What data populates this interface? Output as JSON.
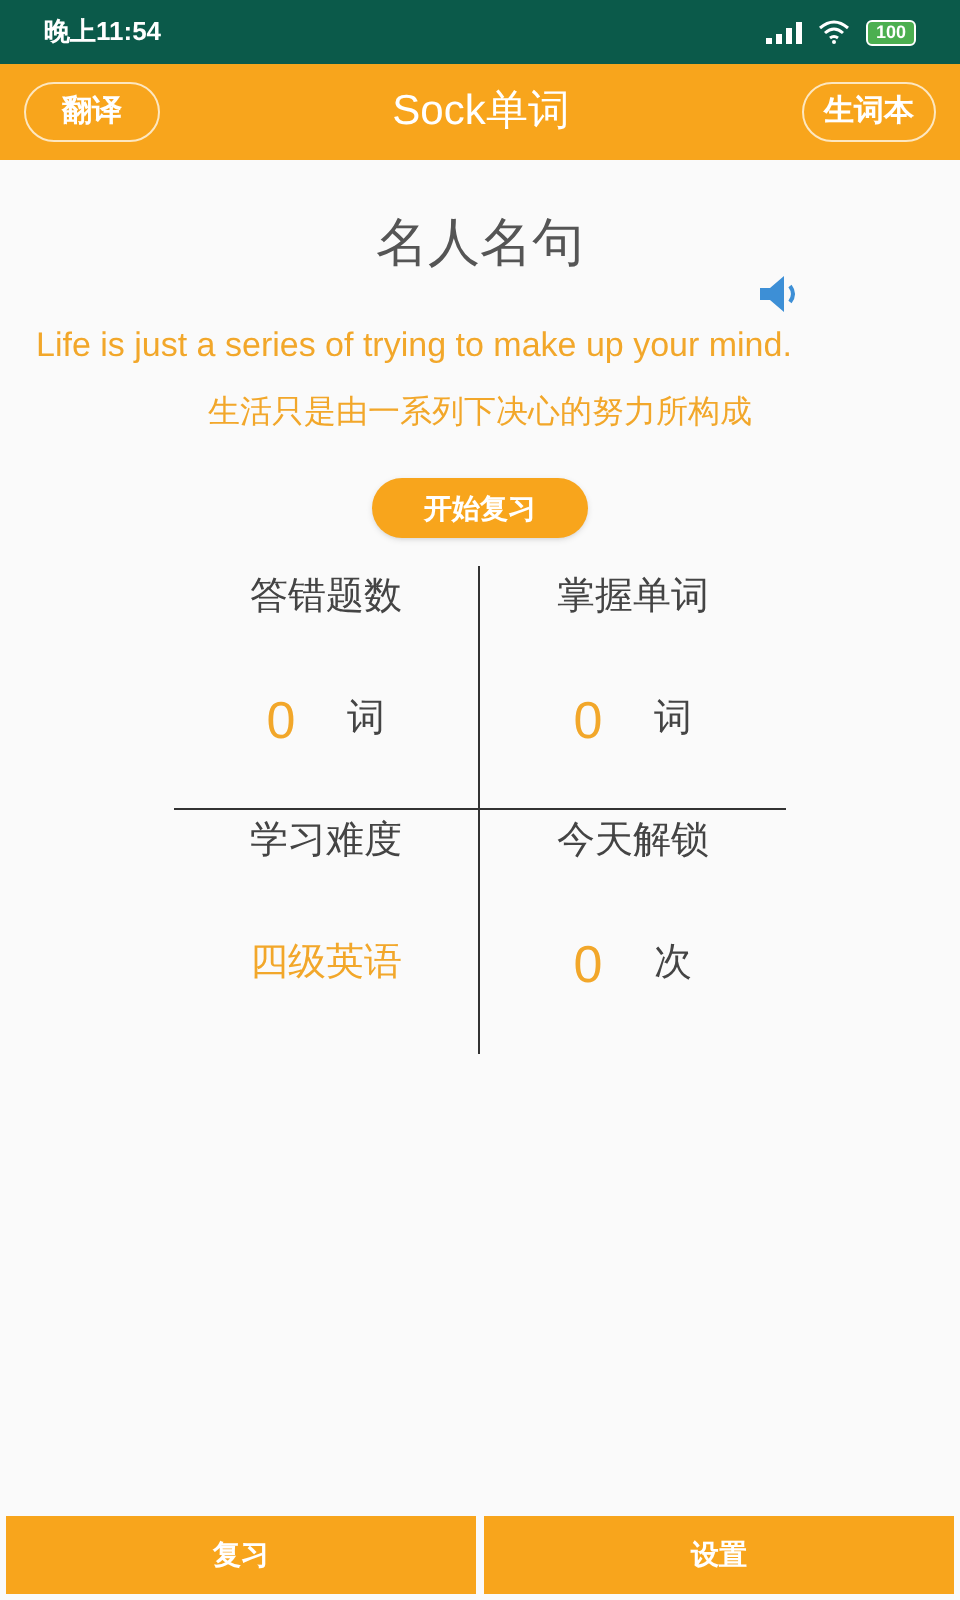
{
  "status_bar": {
    "time": "晚上11:54",
    "battery": "100"
  },
  "header": {
    "left_button": "翻译",
    "title": "Sock单词",
    "right_button": "生词本"
  },
  "quote": {
    "title": "名人名句",
    "english": "Life is just a series of trying to make up your mind.",
    "chinese": "生活只是由一系列下决心的努力所构成"
  },
  "start_button": "开始复习",
  "stats": [
    {
      "label": "答错题数",
      "value": "0",
      "unit": "词"
    },
    {
      "label": "掌握单词",
      "value": "0",
      "unit": "词"
    },
    {
      "label": "学习难度",
      "value": "四级英语"
    },
    {
      "label": "今天解锁",
      "value": "0",
      "unit": "次"
    }
  ],
  "bottom_buttons": [
    "复习",
    "设置"
  ]
}
